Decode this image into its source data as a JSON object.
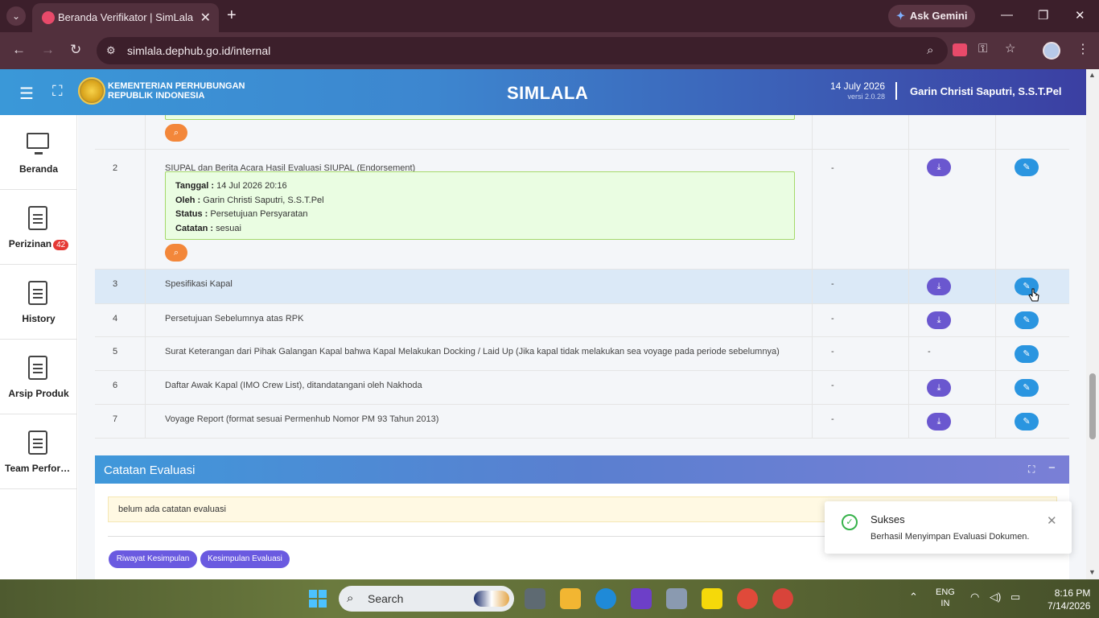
{
  "browser": {
    "tab_title": "Beranda Verifikator | SimLala",
    "gemini_label": "Ask Gemini",
    "url": "simlala.dephub.go.id/internal"
  },
  "header": {
    "ministry_line1": "KEMENTERIAN PERHUBUNGAN",
    "ministry_line2": "REPUBLIK INDONESIA",
    "app_title": "SIMLALA",
    "date": "14 July 2026",
    "version": "versi 2.0.28",
    "user": "Garin Christi Saputri, S.S.T.Pel"
  },
  "sidebar": {
    "items": [
      {
        "label": "Beranda",
        "icon": "monitor-icon"
      },
      {
        "label": "Perizinan",
        "icon": "document-icon",
        "badge": "42"
      },
      {
        "label": "History",
        "icon": "document-icon"
      },
      {
        "label": "Arsip Produk",
        "icon": "document-icon"
      },
      {
        "label": "Team Performance",
        "icon": "document-icon"
      }
    ]
  },
  "documents": {
    "rows": [
      {
        "no": "2",
        "name": "SIUPAL dan Berita Acara Hasil Evaluasi SIUPAL (Endorsement)",
        "col3": "-",
        "tanggal_label": "Tanggal :",
        "tanggal": "14 Jul 2026 20:16",
        "oleh_label": "Oleh :",
        "oleh": "Garin Christi Saputri, S.S.T.Pel",
        "status_label": "Status :",
        "status": "Persetujuan Persyaratan",
        "catatan_label": "Catatan :",
        "catatan": "sesuai"
      },
      {
        "no": "3",
        "name": "Spesifikasi Kapal",
        "col3": "-"
      },
      {
        "no": "4",
        "name": "Persetujuan Sebelumnya atas RPK",
        "col3": "-"
      },
      {
        "no": "5",
        "name": "Surat Keterangan dari Pihak Galangan Kapal bahwa Kapal Melakukan Docking / Laid Up (Jika kapal tidak melakukan sea voyage pada periode sebelumnya)",
        "col3": "-",
        "col4": "-"
      },
      {
        "no": "6",
        "name": "Daftar Awak Kapal (IMO Crew List), ditandatangani oleh Nakhoda",
        "col3": "-"
      },
      {
        "no": "7",
        "name": "Voyage Report (format sesuai Permenhub Nomor PM 93 Tahun 2013)",
        "col3": "-"
      }
    ]
  },
  "evaluation": {
    "title": "Catatan Evaluasi",
    "note": "belum ada catatan evaluasi",
    "btn_history": "Riwayat Kesimpulan",
    "btn_conclusion": "Kesimpulan Evaluasi"
  },
  "toast": {
    "title": "Sukses",
    "message": "Berhasil Menyimpan Evaluasi Dokumen."
  },
  "taskbar": {
    "search_placeholder": "Search",
    "lang_line1": "ENG",
    "lang_line2": "IN",
    "time": "8:16 PM",
    "date": "7/14/2026"
  },
  "colors": {
    "accent_blue": "#2a95e0",
    "accent_purple": "#6a57cf",
    "search_orange": "#f3873a",
    "success_green": "#36b24a"
  }
}
